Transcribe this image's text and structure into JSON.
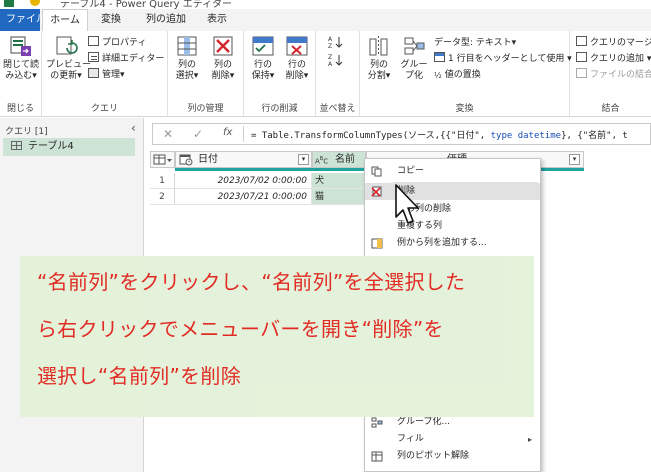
{
  "titlebar": {
    "title": "テーブル4 - Power Query エディター"
  },
  "tabs": [
    {
      "label": "ファイル"
    },
    {
      "label": "ホーム"
    },
    {
      "label": "変換"
    },
    {
      "label": "列の追加"
    },
    {
      "label": "表示"
    }
  ],
  "ribbon": {
    "close": {
      "line1": "閉じて読",
      "line2": "み込む▾",
      "group": "閉じる"
    },
    "query": {
      "preview_line1": "プレビュー",
      "preview_line2": "の更新▾",
      "properties": "プロパティ",
      "advanced_editor": "詳細エディター",
      "manage": "管理▾",
      "group": "クエリ"
    },
    "columns": {
      "choose_line1": "列の",
      "choose_line2": "選択▾",
      "remove_line1": "列の",
      "remove_line2": "削除▾",
      "group": "列の管理"
    },
    "rows": {
      "keep_line1": "行の",
      "keep_line2": "保持▾",
      "remove_line1": "行の",
      "remove_line2": "削除▾",
      "group": "行の削減"
    },
    "sort": {
      "group": "並べ替え"
    },
    "transform": {
      "split_line1": "列の",
      "split_line2": "分割▾",
      "group_line1": "グルー",
      "group_line2": "プ化",
      "datatype": "データ型: テキスト▾",
      "header": "1 行目をヘッダーとして使用 ▾",
      "replace": "値の置換",
      "group": "変換"
    },
    "combine": {
      "merge": "クエリのマージ ▾",
      "append": "クエリの追加 ▾",
      "combine_files": "ファイルの結合",
      "group": "結合"
    }
  },
  "queries_pane": {
    "header": "クエリ [1]",
    "items": [
      {
        "label": "テーブル4"
      }
    ]
  },
  "formula_bar": {
    "prefix": "= Table.TransformColumnTypes(ソース,{{\"日付\", ",
    "kw1": "type datetime",
    "mid": "}, {\"名前\", t"
  },
  "grid": {
    "columns": [
      {
        "name": "日付",
        "type_icon": "calendar-clock-icon"
      },
      {
        "name": "名前",
        "type_icon": "abc-icon"
      },
      {
        "name": "価硬"
      }
    ],
    "rows": [
      {
        "num": "1",
        "date": "2023/07/02 0:00:00",
        "name": "犬"
      },
      {
        "num": "2",
        "date": "2023/07/21 0:00:00",
        "name": "猫"
      }
    ]
  },
  "context_menu": {
    "items": [
      {
        "label": "コピー"
      },
      {
        "label": "削除"
      },
      {
        "label": "他の列の削除"
      },
      {
        "label": "重複する列"
      },
      {
        "label": "例から列を追加する..."
      },
      {
        "label": "グループ化..."
      },
      {
        "label": "フィル"
      },
      {
        "label": "列のピボット解除"
      }
    ]
  },
  "annotation": {
    "line1": "“名前列”をクリックし、“名前列”を全選択した",
    "line2": "ら右クリックでメニューバーを開き“削除”を",
    "line3": "選択し“名前列”を削除"
  },
  "colors": {
    "accent": "#2168c0",
    "selected_column": "#cde3d5",
    "teal_bar": "#20a39e",
    "annotation_text": "#e0241c",
    "annotation_bg": "#e4f2da"
  }
}
